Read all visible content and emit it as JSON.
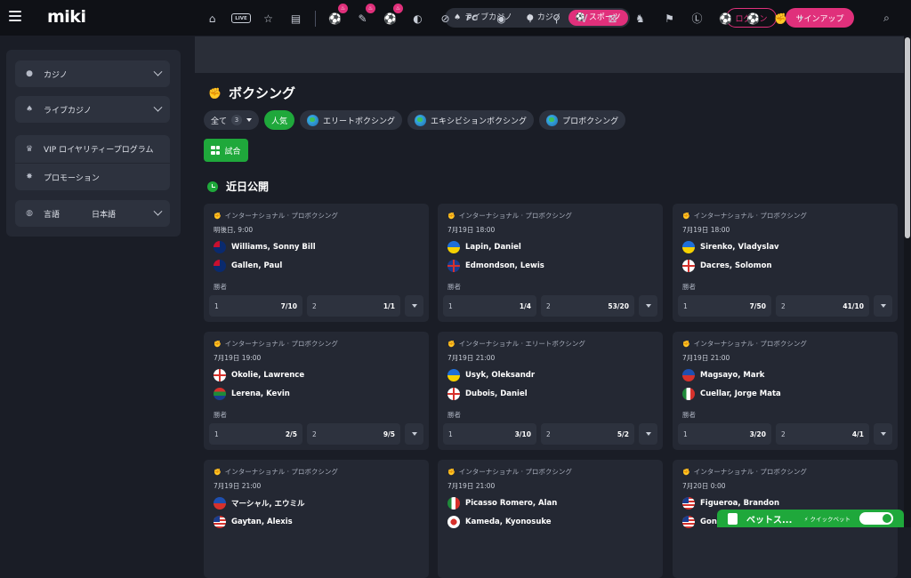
{
  "header": {
    "logo": "miki",
    "modes": [
      {
        "label": "ライブカジノ",
        "icon": "live-casino-icon",
        "active": false
      },
      {
        "label": "カジノ",
        "icon": "casino-icon",
        "active": false
      },
      {
        "label": "スポーツ",
        "icon": "sports-icon",
        "active": true
      }
    ],
    "login_label": "ログイン",
    "signup_label": "サインアップ"
  },
  "sidebar": {
    "casino": "カジノ",
    "live_casino": "ライブカジノ",
    "vip": "VIP ロイヤリティープログラム",
    "promotion": "プロモーション",
    "language_label": "言語",
    "language_value": "日本語"
  },
  "sportsbar": {
    "live_label": "LIVE",
    "esports_label": "FC"
  },
  "page": {
    "title": "ボクシング",
    "filters": [
      {
        "label": "全て",
        "count": "3"
      },
      {
        "label": "人気"
      },
      {
        "label": "エリートボクシング"
      },
      {
        "label": "エキシビションボクシング"
      },
      {
        "label": "プロボクシング"
      }
    ],
    "view_label": "試合",
    "section_title": "近日公開"
  },
  "events": [
    {
      "league": "インターナショナル · プロボクシング",
      "time": "明後日, 9:00",
      "team1": "Williams, Sonny Bill",
      "team2": "Gallen, Paul",
      "flag1": "nz",
      "flag2": "au",
      "market": "勝者",
      "o1_label": "1",
      "o1": "7/10",
      "o2_label": "2",
      "o2": "1/1"
    },
    {
      "league": "インターナショナル · プロボクシング",
      "time": "7月19日 18:00",
      "team1": "Lapin, Daniel",
      "team2": "Edmondson, Lewis",
      "flag1": "ua",
      "flag2": "gb",
      "market": "勝者",
      "o1_label": "1",
      "o1": "1/4",
      "o2_label": "2",
      "o2": "53/20"
    },
    {
      "league": "インターナショナル · プロボクシング",
      "time": "7月19日 18:00",
      "team1": "Sirenko, Vladyslav",
      "team2": "Dacres, Solomon",
      "flag1": "ua",
      "flag2": "en",
      "market": "勝者",
      "o1_label": "1",
      "o1": "7/50",
      "o2_label": "2",
      "o2": "41/10"
    },
    {
      "league": "インターナショナル · プロボクシング",
      "time": "7月19日 19:00",
      "team1": "Okolie, Lawrence",
      "team2": "Lerena, Kevin",
      "flag1": "en",
      "flag2": "za",
      "market": "勝者",
      "o1_label": "1",
      "o1": "2/5",
      "o2_label": "2",
      "o2": "9/5"
    },
    {
      "league": "インターナショナル · エリートボクシング",
      "time": "7月19日 21:00",
      "team1": "Usyk, Oleksandr",
      "team2": "Dubois, Daniel",
      "flag1": "ua",
      "flag2": "en",
      "market": "勝者",
      "o1_label": "1",
      "o1": "3/10",
      "o2_label": "2",
      "o2": "5/2"
    },
    {
      "league": "インターナショナル · プロボクシング",
      "time": "7月19日 21:00",
      "team1": "Magsayo, Mark",
      "team2": "Cuellar, Jorge Mata",
      "flag1": "ph",
      "flag2": "mx",
      "market": "勝者",
      "o1_label": "1",
      "o1": "3/20",
      "o2_label": "2",
      "o2": "4/1"
    },
    {
      "league": "インターナショナル · プロボクシング",
      "time": "7月19日 21:00",
      "team1": "マーシャル, エウミル",
      "team2": "Gaytan, Alexis",
      "flag1": "ph",
      "flag2": "us",
      "market": "",
      "o1_label": "",
      "o1": "",
      "o2_label": "",
      "o2": ""
    },
    {
      "league": "インターナショナル · プロボクシング",
      "time": "7月19日 21:00",
      "team1": "Picasso Romero, Alan",
      "team2": "Kameda, Kyonosuke",
      "flag1": "mx",
      "flag2": "jp",
      "market": "",
      "o1_label": "",
      "o1": "",
      "o2_label": "",
      "o2": ""
    },
    {
      "league": "インターナショナル · プロボクシング",
      "time": "7月20日 0:00",
      "team1": "Figueroa, Brandon",
      "team2": "Gonz",
      "flag1": "us",
      "flag2": "us",
      "market": "",
      "o1_label": "",
      "o1": "",
      "o2_label": "",
      "o2": ""
    }
  ],
  "betslip": {
    "label": "ベットス...",
    "quick_bet": "⚡ クイックベット"
  },
  "colors": {
    "accent_pink": "#e0307b",
    "accent_green": "#1fa83b",
    "background": "#1a1d26",
    "card": "#242833"
  }
}
